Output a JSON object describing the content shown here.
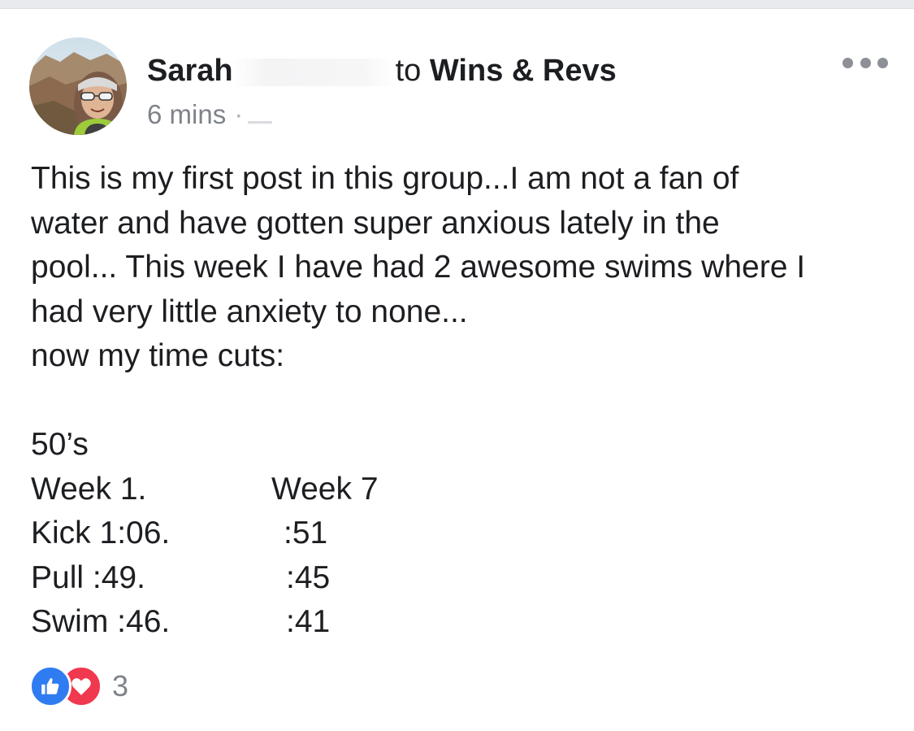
{
  "post": {
    "author_name": "Sarah",
    "to_word": "to",
    "group_name": "Wins & Revs",
    "timestamp": "6 mins",
    "body_lines": [
      "This is my first post in this group...I am not a fan of",
      "water and have gotten super anxious lately in the",
      "pool... This week I have had 2 awesome swims where I",
      "had very little anxiety to none...",
      "now my time cuts:"
    ],
    "section_label": "50’s",
    "times_table": [
      {
        "col1": "Week 1.",
        "col2": "Week 7"
      },
      {
        "col1": "Kick 1:06.",
        "col2": ":51"
      },
      {
        "col1": "Pull :49.",
        "col2": ":45"
      },
      {
        "col1": "Swim :46.",
        "col2": ":41"
      }
    ]
  },
  "reactions": {
    "types": [
      "like-icon",
      "love-icon"
    ],
    "count": "3",
    "like_color": "#2f7cf2",
    "love_color": "#f0384e"
  },
  "icons": {
    "more": "more-options-icon",
    "privacy": "privacy-icon"
  }
}
